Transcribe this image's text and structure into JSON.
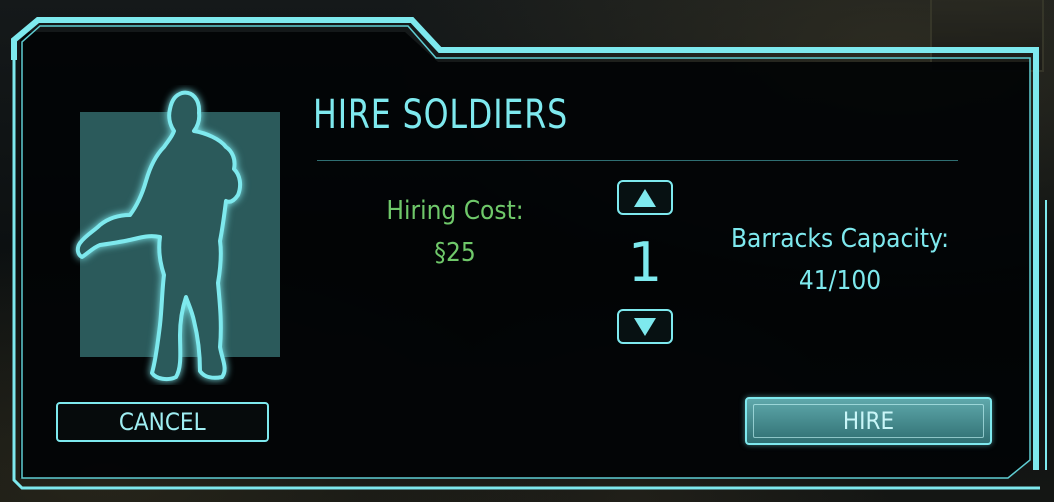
{
  "dialog": {
    "title": "HIRE SOLDIERS",
    "hiring_cost_label": "Hiring Cost:",
    "hiring_cost_value": "§25",
    "quantity": "1",
    "barracks_capacity_label": "Barracks Capacity:",
    "barracks_capacity_value": "41/100",
    "cancel_label": "CANCEL",
    "hire_label": "HIRE"
  },
  "colors": {
    "accent": "#7ee9ee",
    "cost_green": "#6fc86a",
    "panel_bg": "#000000",
    "portrait_bg": "#2b5a5b"
  },
  "icons": {
    "stepper_up": "triangle-up-icon",
    "stepper_down": "triangle-down-icon",
    "portrait": "soldier-silhouette-icon"
  }
}
